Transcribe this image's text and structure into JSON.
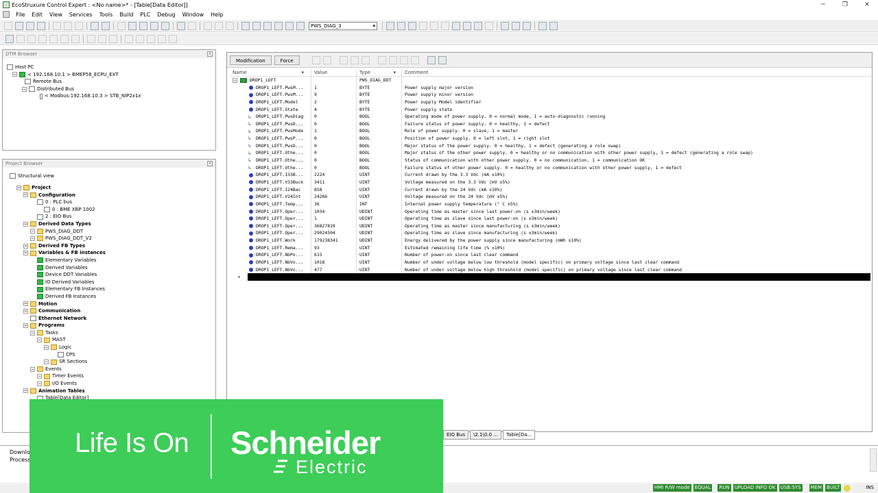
{
  "window": {
    "title": "EcoStruxure Control Expert : <No name>* - [Table[Data Editor]]"
  },
  "menu": [
    "File",
    "Edit",
    "View",
    "Services",
    "Tools",
    "Build",
    "PLC",
    "Debug",
    "Window",
    "Help"
  ],
  "toolbar": {
    "combo_value": "PWS_DIAG_3"
  },
  "dtm_browser": {
    "title": "DTM Browser",
    "tree": [
      {
        "label": "Host PC",
        "level": 0
      },
      {
        "label": "< 192.168.10.1 > BMEP58_ECPU_EXT",
        "level": 1
      },
      {
        "label": "Remote Bus",
        "level": 2
      },
      {
        "label": "Distributed Bus",
        "level": 2
      },
      {
        "label": "< Modbus:192.168.10.3 > STB_NIP2x1x",
        "level": 3
      }
    ]
  },
  "project_browser": {
    "title": "Project Browser",
    "view": "Structural view",
    "tree": [
      {
        "label": "Project",
        "level": 0,
        "bold": true,
        "icon": "folder"
      },
      {
        "label": "Configuration",
        "level": 1,
        "bold": true,
        "icon": "folder"
      },
      {
        "label": "0 : PLC bus",
        "level": 2,
        "icon": "doc"
      },
      {
        "label": "0 : BME XBP 1002",
        "level": 3,
        "icon": "doc"
      },
      {
        "label": "2 : EIO Bus",
        "level": 2,
        "icon": "doc"
      },
      {
        "label": "Derived Data Types",
        "level": 1,
        "bold": true,
        "icon": "folder"
      },
      {
        "label": "PWS_DIAG_DDT",
        "level": 2,
        "icon": "folder"
      },
      {
        "label": "PWS_DIAG_DDT_V2",
        "level": 2,
        "icon": "folder"
      },
      {
        "label": "Derived FB Types",
        "level": 1,
        "bold": true,
        "icon": "folder"
      },
      {
        "label": "Variables & FB instances",
        "level": 1,
        "bold": true,
        "icon": "folder"
      },
      {
        "label": "Elementary Variables",
        "level": 2,
        "icon": "green"
      },
      {
        "label": "Derived Variables",
        "level": 2,
        "icon": "green"
      },
      {
        "label": "Device DDT Variables",
        "level": 2,
        "icon": "green"
      },
      {
        "label": "IO Derived Variables",
        "level": 2,
        "icon": "green"
      },
      {
        "label": "Elementary FB Instances",
        "level": 2,
        "icon": "green"
      },
      {
        "label": "Derived FB Instances",
        "level": 2,
        "icon": "green"
      },
      {
        "label": "Motion",
        "level": 1,
        "bold": true,
        "icon": "folder"
      },
      {
        "label": "Communication",
        "level": 1,
        "bold": true,
        "icon": "folder"
      },
      {
        "label": "Ethernet Network",
        "level": 1,
        "bold": true,
        "icon": "doc"
      },
      {
        "label": "Programs",
        "level": 1,
        "bold": true,
        "icon": "folder"
      },
      {
        "label": "Tasks",
        "level": 2,
        "icon": "folder"
      },
      {
        "label": "MAST",
        "level": 3,
        "icon": "folder"
      },
      {
        "label": "Logic",
        "level": 4,
        "icon": "folder"
      },
      {
        "label": "CPS",
        "level": 5,
        "icon": "doc"
      },
      {
        "label": "SR Sections",
        "level": 4,
        "icon": "folder"
      },
      {
        "label": "Events",
        "level": 2,
        "icon": "folder"
      },
      {
        "label": "Timer Events",
        "level": 3,
        "icon": "folder"
      },
      {
        "label": "I/O Events",
        "level": 3,
        "icon": "folder"
      },
      {
        "label": "Animation Tables",
        "level": 1,
        "bold": true,
        "icon": "folder"
      },
      {
        "label": "Table[Data Editor]",
        "level": 2,
        "icon": "doc"
      }
    ]
  },
  "editor": {
    "modes": [
      "Modification",
      "Force"
    ],
    "columns": [
      "Name",
      "Value",
      "Type",
      "Comment"
    ],
    "header_row": {
      "name": "DROP1_LEFT",
      "value": "",
      "type": "PWS_DIAG_DDT",
      "comment": ""
    },
    "rows": [
      {
        "name": "DROP1_LEFT.PwsM...",
        "value": "1",
        "type": "BYTE",
        "comment": "Power supply major version",
        "icon": "dot"
      },
      {
        "name": "DROP1_LEFT.PwsM...",
        "value": "9",
        "type": "BYTE",
        "comment": "Power supply minor version",
        "icon": "dot"
      },
      {
        "name": "DROP1_LEFT.Model",
        "value": "2",
        "type": "BYTE",
        "comment": "Power supply Model identifier",
        "icon": "dot"
      },
      {
        "name": "DROP1_LEFT.State",
        "value": "4",
        "type": "BYTE",
        "comment": "Power supply state",
        "icon": "dot"
      },
      {
        "name": "DROP1_LEFT.PwsDiag",
        "value": "0",
        "type": "BOOL",
        "comment": "Operating mode of power supply. 0 = normal mode, 1 = auto-diagnostic running",
        "icon": "arrow"
      },
      {
        "name": "DROP1_LEFT.PwsD...",
        "value": "0",
        "type": "BOOL",
        "comment": "Failure status of power supply. 0 = healthy, 1 = defect",
        "icon": "arrow"
      },
      {
        "name": "DROP1_LEFT.PwsMode",
        "value": "1",
        "type": "BOOL",
        "comment": "Role of power supply. 0 = slave, 1 = master",
        "icon": "arrow"
      },
      {
        "name": "DROP1_LEFT.PwsP...",
        "value": "0",
        "type": "BOOL",
        "comment": "Position of power supply. 0 = left slot, 1 = right slot",
        "icon": "arrow"
      },
      {
        "name": "DROP1_LEFT.PwsD...",
        "value": "0",
        "type": "BOOL",
        "comment": "Major status of the power supply. 0 = healthy, 1 = defect (generating a role swap)",
        "icon": "arrow"
      },
      {
        "name": "DROP1_LEFT.Othe...",
        "value": "0",
        "type": "BOOL",
        "comment": "Major status of the other power supply. 0 = healthy or no communication with other power supply, 1 = defect (generating a role swap)",
        "icon": "arrow"
      },
      {
        "name": "DROP1_LEFT.Othe...",
        "value": "0",
        "type": "BOOL",
        "comment": "Status of communication with other power supply. 0 = no communication, 1 = communication OK",
        "icon": "arrow"
      },
      {
        "name": "DROP1_LEFT.Othe...",
        "value": "0",
        "type": "BOOL",
        "comment": "Failure status of other power supply. 0 = healthy or no communication with other power supply, 1 = defect",
        "icon": "arrow"
      },
      {
        "name": "DROP1_LEFT.I33B...",
        "value": "2224",
        "type": "UINT",
        "comment": "Current drawn by the 3.3 Vdc (mA ±10%)",
        "icon": "dot"
      },
      {
        "name": "DROP1_LEFT.V33Buck",
        "value": "3411",
        "type": "UINT",
        "comment": "Voltage measured on the 3.3 Vdc (mV ±5%)",
        "icon": "dot"
      },
      {
        "name": "DROP1_LEFT.I24Bac",
        "value": "858",
        "type": "UINT",
        "comment": "Current drawn by the 24 Vdc (mA ±10%)",
        "icon": "dot"
      },
      {
        "name": "DROP1_LEFT.V24Int",
        "value": "24266",
        "type": "UINT",
        "comment": "Voltage measured on the 24 Vdc (mV ±5%)",
        "icon": "dot"
      },
      {
        "name": "DROP1_LEFT.Temp...",
        "value": "36",
        "type": "INT",
        "comment": "Internal power supply temperature (° C ±5%)",
        "icon": "dot"
      },
      {
        "name": "DROP1_LEFT.Oper...",
        "value": "1034",
        "type": "UDINT",
        "comment": "Operating time as master since last power-on (s ±3min/week)",
        "icon": "dot"
      },
      {
        "name": "DROP1_LEFT.Oper...",
        "value": "1",
        "type": "UDINT",
        "comment": "Operating time as slave since last power-on (s ±3min/week)",
        "icon": "dot"
      },
      {
        "name": "DROP1_LEFT.Oper...",
        "value": "36827819",
        "type": "UDINT",
        "comment": "Operating time as master since manufacturing (s ±3min/week)",
        "icon": "dot"
      },
      {
        "name": "DROP1_LEFT.Oper...",
        "value": "29024504",
        "type": "UDINT",
        "comment": "Operating time as slave since manufacturing (s ±3min/week)",
        "icon": "dot"
      },
      {
        "name": "DROP1_LEFT.Work",
        "value": "179238341",
        "type": "UDINT",
        "comment": "Energy delivered by the power supply since manufacturing (mWh ±10%)",
        "icon": "dot"
      },
      {
        "name": "DROP1_LEFT.Rema...",
        "value": "93",
        "type": "UINT",
        "comment": "Estimated remaining life time (% ±10%)",
        "icon": "dot"
      },
      {
        "name": "DROP1_LEFT.NbPo...",
        "value": "615",
        "type": "UINT",
        "comment": "Number of power-on since last clear command",
        "icon": "dot"
      },
      {
        "name": "DROP1_LEFT.NbVo...",
        "value": "1018",
        "type": "UINT",
        "comment": "Number of under voltage below low threshold (model specific) on primary voltage since last clear command",
        "icon": "dot"
      },
      {
        "name": "DROP1_LEFT.NbVo...",
        "value": "477",
        "type": "UINT",
        "comment": "Number of under voltage below high threshold (model specific) on primary voltage since last clear command",
        "icon": "dot"
      }
    ]
  },
  "bottom_tabs": [
    "EIO Bus",
    "\\2.1\\0.0 ...",
    "Table[Da..."
  ],
  "output": {
    "lines": [
      "Downlo",
      "Process"
    ]
  },
  "statusbar": [
    "HMI R/W mode",
    "EQUAL",
    "RUN",
    "UPLOAD INFO OK",
    "USB:SYS",
    "MEM",
    "BUILT",
    "INS"
  ],
  "banner": {
    "tagline": "Life Is On",
    "brand": "Schneider",
    "brand2": "Electric"
  }
}
